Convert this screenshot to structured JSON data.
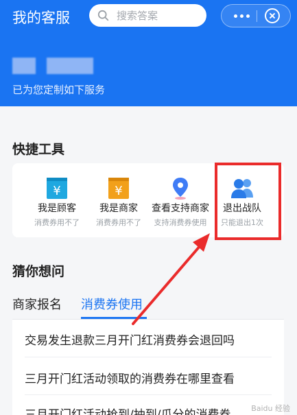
{
  "header": {
    "title": "我的客服",
    "search_placeholder": "搜索答案",
    "subtitle": "已为您定制如下服务",
    "menu_icon": "more-dots-icon",
    "close_icon": "close-circle-icon"
  },
  "quick_tools": {
    "title": "快捷工具",
    "items": [
      {
        "label": "我是顾客",
        "sub": "消费券用不了",
        "icon": "yuan-bag-icon",
        "color": "#1fa8e0"
      },
      {
        "label": "我是商家",
        "sub": "消费券用不了",
        "icon": "yuan-bag-icon",
        "color": "#f2a01a"
      },
      {
        "label": "查看支持商家",
        "sub": "支持消费券使用",
        "icon": "location-pin-icon",
        "color": "#3f7cf6"
      },
      {
        "label": "退出战队",
        "sub": "只能退出1次",
        "icon": "users-icon",
        "color": "#2a7be8"
      }
    ]
  },
  "guess": {
    "title": "猜你想问",
    "tabs": [
      {
        "label": "商家报名",
        "active": false
      },
      {
        "label": "消费券使用",
        "active": true
      }
    ],
    "questions": [
      "交易发生退款三月开门红消费券会退回吗",
      "三月开门红活动领取的消费券在哪里查看",
      "三月开门红活动抢到/抽到/瓜分的消费券"
    ]
  },
  "colors": {
    "primary": "#1a74f2",
    "highlight": "#ea2b2b"
  },
  "watermark": "Baidu 经验"
}
